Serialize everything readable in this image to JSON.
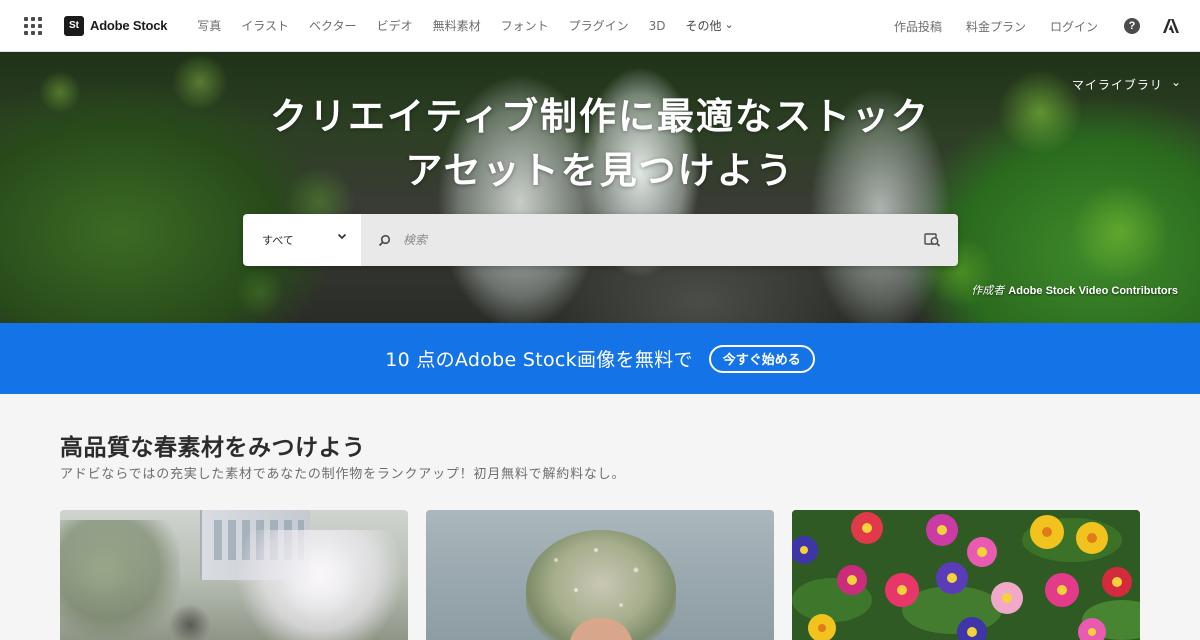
{
  "nav": {
    "brand_badge": "St",
    "brand_name": "Adobe Stock",
    "links": [
      "写真",
      "イラスト",
      "ベクター",
      "ビデオ",
      "無料素材",
      "フォント",
      "プラグイン",
      "3D",
      "その他"
    ],
    "right_links": [
      "作品投稿",
      "料金プラン",
      "ログイン"
    ],
    "help_glyph": "?"
  },
  "hero": {
    "title_line1": "クリエイティブ制作に最適なストック",
    "title_line2": "アセットを見つけよう",
    "my_library": "マイライブラリ",
    "search": {
      "type_value": "すべて",
      "placeholder": "検索"
    },
    "credit_prefix": "作成者",
    "credit_name": "Adobe Stock Video Contributors"
  },
  "promo": {
    "text": "10 点のAdobe Stock画像を無料で",
    "button": "今すぐ始める"
  },
  "section": {
    "title": "高品質な春素材をみつけよう",
    "subtitle": "アドビならではの充実した素材であなたの制作物をランクアップ！初月無料で解約料なし。"
  },
  "colors": {
    "accent": "#1473e6",
    "nav_bg": "#ffffff",
    "page_bg": "#f5f5f5"
  },
  "icons": {
    "apps": "apps-grid-icon",
    "help": "help-icon",
    "adobe": "adobe-logo-icon",
    "search": "search-icon",
    "visual_search": "visual-search-icon",
    "chevron": "chevron-down-icon"
  }
}
